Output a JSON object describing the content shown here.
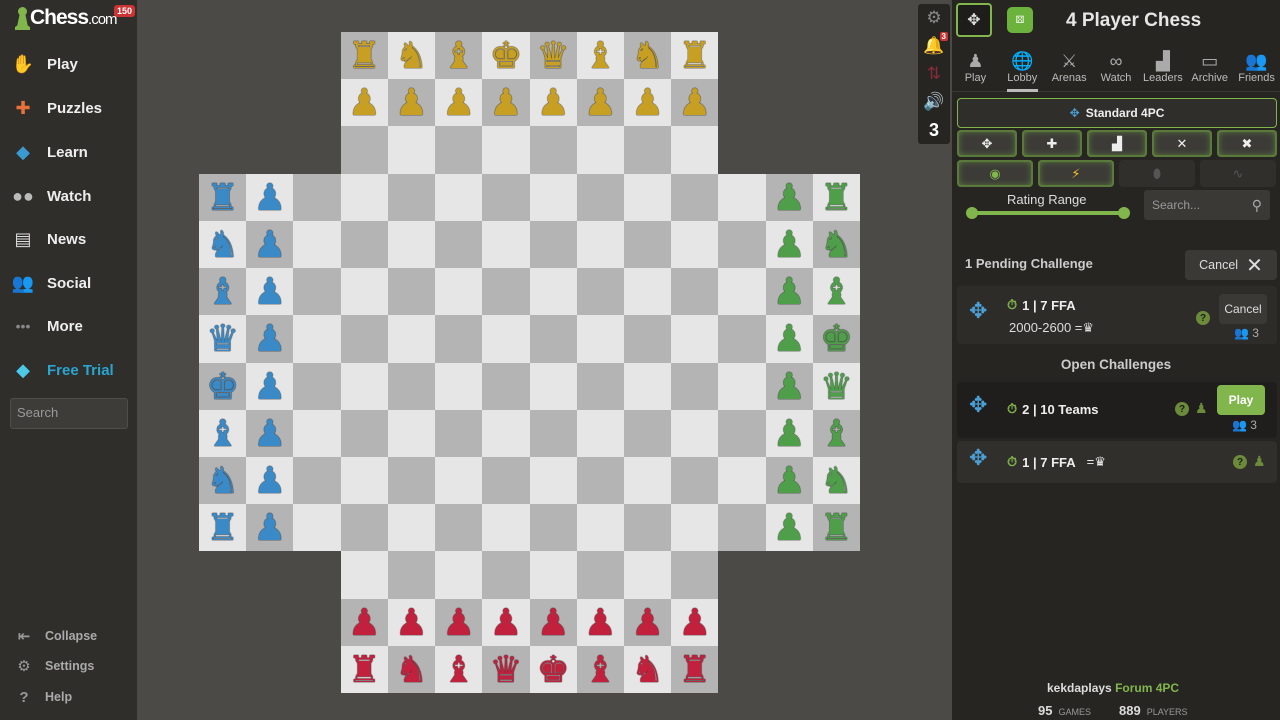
{
  "sidebar": {
    "logo": {
      "text": "Chess",
      "suffix": ".com",
      "badge": "150"
    },
    "items": [
      {
        "label": "Play",
        "icon": "play-hand-icon"
      },
      {
        "label": "Puzzles",
        "icon": "puzzle-icon"
      },
      {
        "label": "Learn",
        "icon": "graduation-cap-icon"
      },
      {
        "label": "Watch",
        "icon": "binoculars-icon"
      },
      {
        "label": "News",
        "icon": "newspaper-icon"
      },
      {
        "label": "Social",
        "icon": "people-icon"
      },
      {
        "label": "More",
        "icon": "ellipsis-icon"
      },
      {
        "label": "Free Trial",
        "icon": "diamond-icon"
      }
    ],
    "search_placeholder": "Search",
    "footer": [
      {
        "label": "Collapse",
        "icon": "collapse-icon"
      },
      {
        "label": "Settings",
        "icon": "gear-icon"
      },
      {
        "label": "Help",
        "icon": "help-icon"
      }
    ]
  },
  "board": {
    "colors": {
      "yellow": "#c79f23",
      "blue": "#3b8ac8",
      "green": "#4f9e4a",
      "red": "#c2213e",
      "light": "#e6e6e6",
      "dark": "#b4b4b4"
    },
    "yellow_back_rank": [
      "R",
      "N",
      "B",
      "K",
      "Q",
      "B",
      "N",
      "R"
    ],
    "blue_back_rank": [
      "R",
      "N",
      "B",
      "Q",
      "K",
      "B",
      "N",
      "R"
    ],
    "green_back_rank": [
      "R",
      "N",
      "B",
      "K",
      "Q",
      "B",
      "N",
      "R"
    ],
    "red_back_rank": [
      "R",
      "N",
      "B",
      "Q",
      "K",
      "B",
      "N",
      "R"
    ]
  },
  "strip": {
    "notifications_badge": "3",
    "bottom_count": "3"
  },
  "panel": {
    "title": "4 Player Chess",
    "tabs": [
      {
        "label": "Play",
        "icon": "play-icon",
        "active": false
      },
      {
        "label": "Lobby",
        "icon": "globe-icon",
        "active": true
      },
      {
        "label": "Arenas",
        "icon": "crossed-swords-icon",
        "active": false
      },
      {
        "label": "Watch",
        "icon": "binoculars-icon",
        "active": false
      },
      {
        "label": "Leaders",
        "icon": "podium-icon",
        "active": false
      },
      {
        "label": "Archive",
        "icon": "folder-icon",
        "active": false
      },
      {
        "label": "Friends",
        "icon": "friends-icon",
        "active": false
      }
    ],
    "variant_button": "Standard 4PC",
    "rating_range_label": "Rating Range",
    "search_placeholder": "Search...",
    "pending": {
      "title": "1 Pending Challenge",
      "cancel_all": "Cancel",
      "challenge": {
        "time": "1 | 7 FFA",
        "rating": "2000-2600",
        "rating_suffix": "=♛",
        "cancel": "Cancel",
        "count": "3"
      }
    },
    "open_title": "Open Challenges",
    "open": [
      {
        "time": "2 | 10 Teams",
        "action": "Play",
        "count": "3"
      },
      {
        "time": "1 | 7 FFA",
        "suffix": "=♛"
      }
    ],
    "footer": {
      "user": "kekdaplays",
      "forum_link": "Forum 4PC",
      "games": "95",
      "games_label": "GAMES",
      "players": "889",
      "players_label": "PLAYERS"
    }
  }
}
